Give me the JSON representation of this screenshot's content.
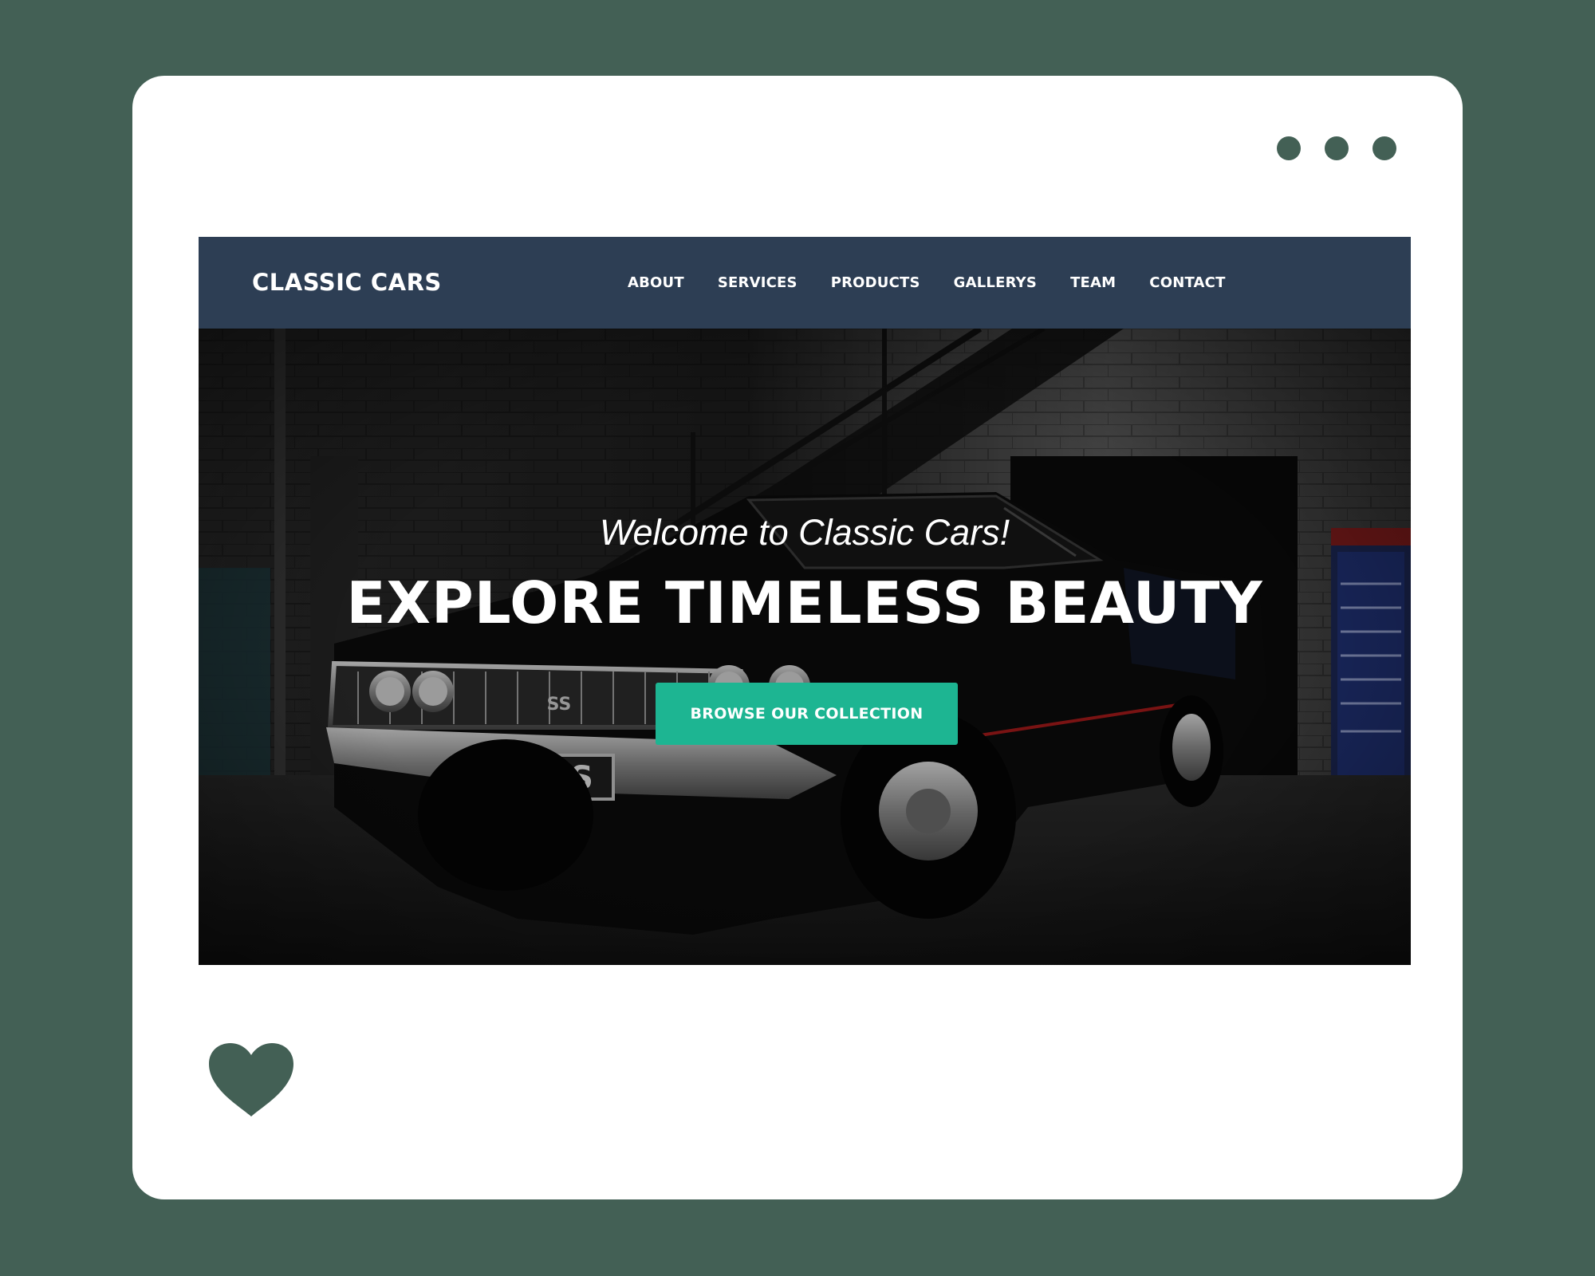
{
  "site": {
    "brand": "CLASSIC CARS",
    "nav": [
      "ABOUT",
      "SERVICES",
      "PRODUCTS",
      "GALLERYS",
      "TEAM",
      "CONTACT"
    ]
  },
  "hero": {
    "welcome": "Welcome to Classic Cars!",
    "headline": "EXPLORE TIMELESS BEAUTY",
    "cta_label": "BROWSE OUR COLLECTION",
    "plate_text": "SS",
    "grille_badge": "SS"
  },
  "icons": {
    "window_dots": "ellipsis-dots",
    "favorite": "heart-icon"
  },
  "colors": {
    "background": "#436055",
    "navbar": "#2d3e54",
    "cta": "#1db592",
    "card": "#ffffff"
  }
}
